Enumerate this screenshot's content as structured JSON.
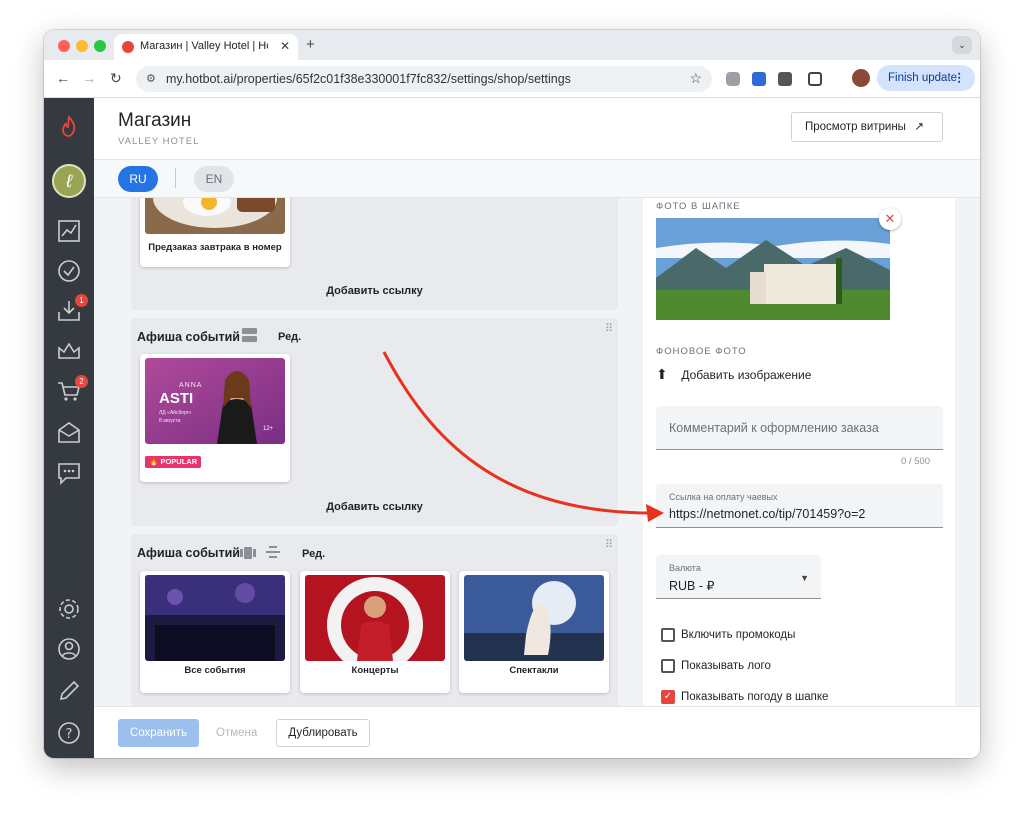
{
  "browser": {
    "tab_title": "Магазин | Valley Hotel | Hotbot",
    "url": "my.hotbot.ai/properties/65f2c01f38e330001f7fc832/settings/shop/settings",
    "finish_update_label": "Finish update",
    "tab_menu": "⌄"
  },
  "header": {
    "title": "Магазин",
    "subtitle": "VALLEY HOTEL",
    "preview_button_label": "Просмотр витрины"
  },
  "languages": [
    {
      "label": "RU",
      "active": true
    },
    {
      "label": "EN",
      "active": false
    }
  ],
  "sidebar": {
    "badges": {
      "inbox": "1",
      "cart": "2"
    }
  },
  "left": {
    "block1": {
      "card_label": "Предзаказ завтрака в номер",
      "add_link_label": "Добавить ссылку"
    },
    "block2": {
      "title": "Афиша событий",
      "edit_label": "Ред.",
      "card_poster_name": "ANNA",
      "card_poster_brand": "ASTI",
      "card_poster_venue": "ЛД «Айсберг»",
      "card_poster_date": "8 августа",
      "card_poster_age": "12+",
      "popular_label": "POPULAR",
      "add_link_label": "Добавить ссылку"
    },
    "block3": {
      "title": "Афиша событий",
      "edit_label": "Ред.",
      "cards": [
        {
          "label": "Все события"
        },
        {
          "label": "Концерты"
        },
        {
          "label": "Спектакли"
        }
      ]
    }
  },
  "right": {
    "header_photo_label": "ФОТО В ШАПКЕ",
    "background_photo_label": "ФОНОВОЕ ФОТО",
    "add_image_label": "Добавить изображение",
    "comment_placeholder": "Комментарий к оформлению заказа",
    "comment_counter": "0 / 500",
    "tip_link_label": "Ссылка на оплату чаевых",
    "tip_link_value": "https://netmonet.co/tip/701459?o=2",
    "currency_label": "Валюта",
    "currency_value": "RUB - ₽",
    "checkboxes": [
      {
        "label": "Включить промокоды",
        "checked": false
      },
      {
        "label": "Показывать лого",
        "checked": false
      },
      {
        "label": "Показывать погоду в шапке",
        "checked": true
      }
    ]
  },
  "footer": {
    "save_label": "Сохранить",
    "cancel_label": "Отмена",
    "duplicate_label": "Дублировать"
  },
  "colors": {
    "accent": "#2474e5",
    "brand": "#e8453c",
    "sidebar": "#353a40",
    "annotation_arrow": "#e8321e"
  }
}
